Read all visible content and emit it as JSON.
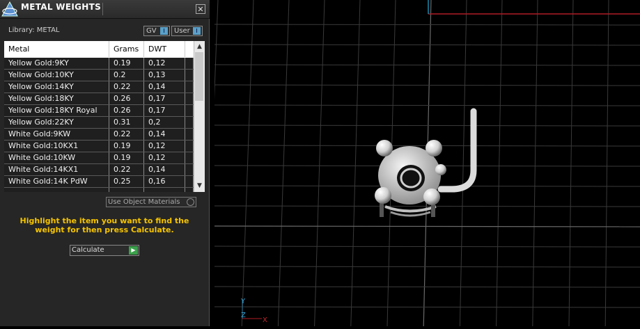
{
  "panel": {
    "title": "METAL WEIGHTS",
    "close_symbol": "✕",
    "library_label": "Library: METAL",
    "scope_buttons": [
      {
        "label": "GV",
        "indicator": "I"
      },
      {
        "label": "User",
        "indicator": "I"
      }
    ],
    "table": {
      "headers": [
        "Metal",
        "Grams",
        "DWT"
      ],
      "rows": [
        [
          "Yellow Gold:9KY",
          "0.19",
          "0,12"
        ],
        [
          "Yellow Gold:10KY",
          "0.2",
          "0,13"
        ],
        [
          "Yellow Gold:14KY",
          "0.22",
          "0,14"
        ],
        [
          "Yellow Gold:18KY",
          "0.26",
          "0,17"
        ],
        [
          "Yellow Gold:18KY Royal",
          "0.26",
          "0,17"
        ],
        [
          "Yellow Gold:22KY",
          "0.31",
          "0,2"
        ],
        [
          "White Gold:9KW",
          "0.22",
          "0,14"
        ],
        [
          "White Gold:10KX1",
          "0.19",
          "0,12"
        ],
        [
          "White Gold:10KW",
          "0.19",
          "0,12"
        ],
        [
          "White Gold:14KX1",
          "0.22",
          "0,14"
        ],
        [
          "White Gold:14K PdW",
          "0.25",
          "0,16"
        ]
      ],
      "scroll_up": "▲",
      "scroll_down": "▼"
    },
    "use_object_materials": "Use Object Materials",
    "instructions": "Highlight the item you want to find the weight for then press Calculate.",
    "calculate_label": "Calculate",
    "calculate_icon": "play-icon"
  },
  "viewport": {
    "axis_labels": {
      "y": "Y",
      "z": "Z",
      "x": "X"
    },
    "colors": {
      "grid": "#3a3a3a",
      "grid_major": "#6a6a6a",
      "axis_x": "#c0202a",
      "axis_y": "#1a8ab0",
      "model": "#e0e0e0"
    }
  }
}
